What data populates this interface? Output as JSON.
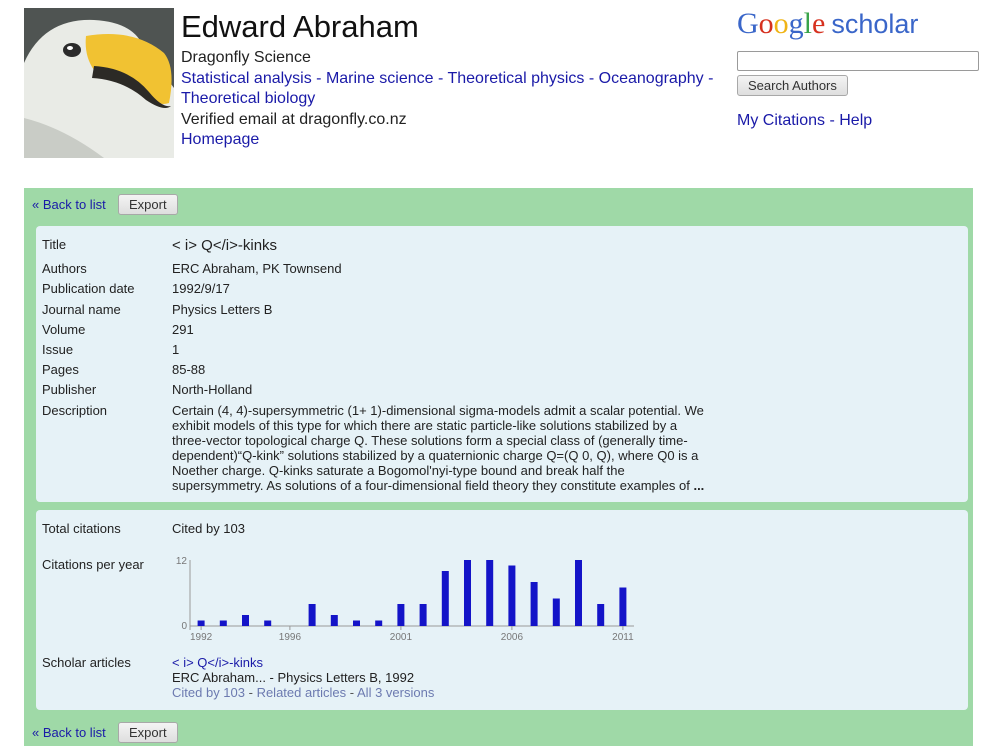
{
  "profile": {
    "name": "Edward Abraham",
    "affiliation": "Dragonfly Science",
    "interests": [
      "Statistical analysis",
      "Marine science",
      "Theoretical physics",
      "Oceanography",
      "Theoretical biology"
    ],
    "interest_sep": " - ",
    "email": "Verified email at dragonfly.co.nz",
    "homepage": "Homepage"
  },
  "header_right": {
    "logo_google": "Google",
    "logo_scholar": "scholar",
    "search_value": "",
    "search_button": "Search Authors",
    "my_citations": "My Citations",
    "sep": " - ",
    "help": "Help"
  },
  "nav": {
    "back": "« Back to list",
    "export": "Export"
  },
  "details": {
    "title_label": "Title",
    "title": "< i> Q</i>-kinks",
    "authors_label": "Authors",
    "authors": "ERC Abraham, PK Townsend",
    "date_label": "Publication date",
    "date": "1992/9/17",
    "journal_label": "Journal name",
    "journal": "Physics Letters B",
    "volume_label": "Volume",
    "volume": "291",
    "issue_label": "Issue",
    "issue": "1",
    "pages_label": "Pages",
    "pages": "85-88",
    "publisher_label": "Publisher",
    "publisher": "North-Holland",
    "description_label": "Description",
    "description": "Certain (4, 4)-supersymmetric (1+ 1)-dimensional sigma-models admit a scalar potential. We exhibit models of this type for which there are static particle-like solutions stabilized by a three-vector topological charge Q. These solutions form a special class of (generally time-dependent)“Q-kink” solutions stabilized by a quaternionic charge Q=(Q 0, Q), where Q0 is a Noether charge. Q-kinks saturate a Bogomol'nyi-type bound and break half the supersymmetry. As solutions of a four-dimensional field theory they constitute examples of ",
    "description_more": "..."
  },
  "citations": {
    "total_label": "Total citations",
    "cited_by": "Cited by 103",
    "per_year_label": "Citations per year",
    "scholar_label": "Scholar articles",
    "article_title": "< i> Q</i>-kinks",
    "article_source": "ERC Abraham... - Physics Letters B, 1992",
    "article_cited": "Cited by 103",
    "article_related": "Related articles",
    "article_versions": "All 3 versions",
    "article_sep": " - "
  },
  "chart_data": {
    "type": "bar",
    "categories": [
      1992,
      1993,
      1994,
      1995,
      1996,
      1997,
      1998,
      1999,
      2000,
      2001,
      2002,
      2003,
      2004,
      2005,
      2006,
      2007,
      2008,
      2009,
      2010,
      2011
    ],
    "values": [
      1,
      1,
      2,
      1,
      0,
      4,
      2,
      1,
      1,
      4,
      4,
      10,
      12,
      12,
      11,
      8,
      5,
      12,
      4,
      7
    ],
    "ylim": [
      0,
      12
    ],
    "yticks": [
      "0",
      "12"
    ],
    "xticks": [
      "1992",
      "1996",
      "2001",
      "2006",
      "2011"
    ],
    "bar_color": "#1414c8"
  }
}
